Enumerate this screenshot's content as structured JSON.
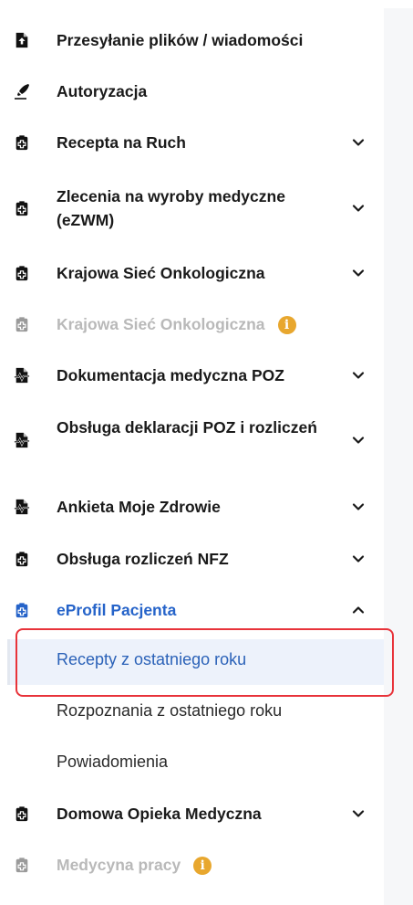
{
  "colors": {
    "accent": "#2563c9",
    "disabled": "#b9b9b9",
    "info_badge": "#e8a72e",
    "highlight_border": "#e8333a"
  },
  "menu": [
    {
      "label": "Przesyłanie plików / wiadomości",
      "icon": "file-upload-icon",
      "chevron": false
    },
    {
      "label": "Autoryzacja",
      "icon": "signature-pen-icon",
      "chevron": false
    },
    {
      "label": "Recepta na Ruch",
      "icon": "clipboard-medical-icon",
      "chevron": "down"
    },
    {
      "label": "Zlecenia na wyroby medyczne (eZWM)",
      "icon": "clipboard-medical-icon",
      "chevron": "down"
    },
    {
      "label": "Krajowa Sieć Onkologiczna",
      "icon": "clipboard-medical-icon",
      "chevron": "down"
    },
    {
      "label": "Krajowa Sieć Onkologiczna",
      "icon": "clipboard-medical-icon",
      "disabled": true,
      "info": "i"
    },
    {
      "label": "Dokumentacja medyczna POZ",
      "icon": "file-medical-icon",
      "chevron": "down"
    },
    {
      "label": "Obsługa deklaracji POZ i rozliczeń",
      "icon": "file-medical-icon",
      "chevron": "down"
    },
    {
      "label": "Ankieta Moje Zdrowie",
      "icon": "file-medical-icon",
      "chevron": "down"
    },
    {
      "label": "Obsługa rozliczeń NFZ",
      "icon": "clipboard-medical-icon",
      "chevron": "down"
    },
    {
      "label": "eProfil Pacjenta",
      "icon": "clipboard-medical-icon",
      "chevron": "up",
      "active": true
    },
    {
      "label": "Domowa Opieka Medyczna",
      "icon": "clipboard-medical-icon",
      "chevron": "down"
    },
    {
      "label": "Medycyna pracy",
      "icon": "clipboard-medical-icon",
      "disabled": true,
      "info": "i"
    }
  ],
  "submenu": [
    {
      "label": "Recepty z ostatniego roku",
      "active": true
    },
    {
      "label": "Rozpoznania z ostatniego roku"
    },
    {
      "label": "Powiadomienia"
    }
  ]
}
